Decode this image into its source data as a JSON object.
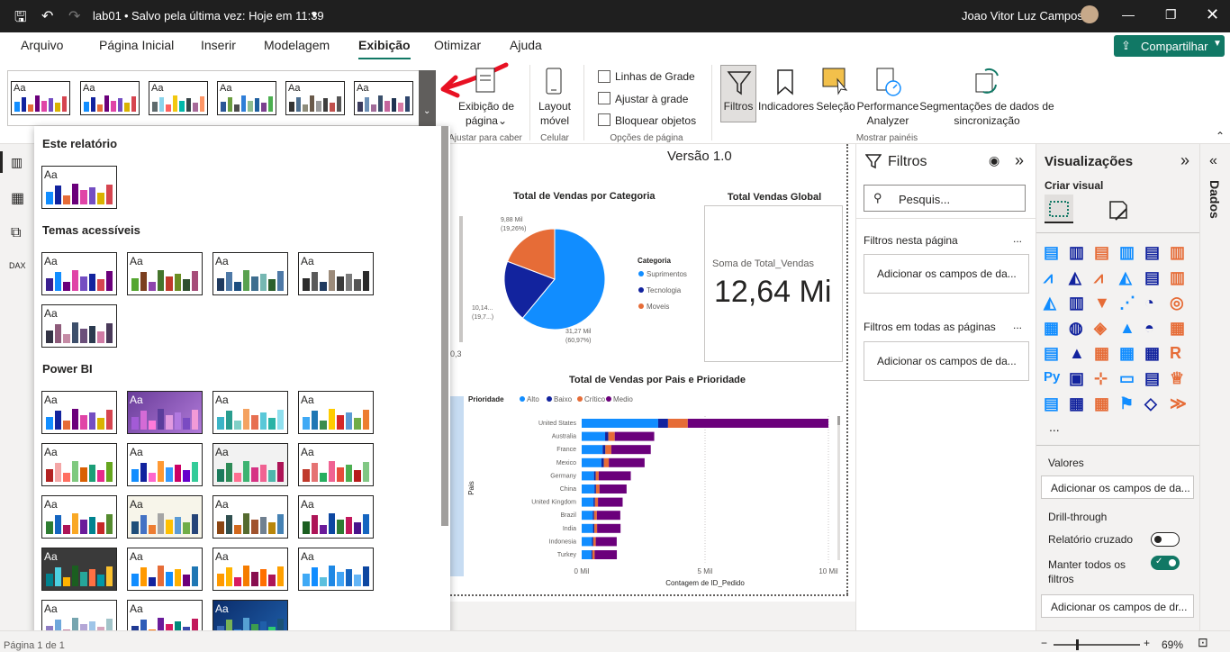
{
  "titlebar": {
    "file": "lab01",
    "save_status": "Salvo pela última vez: Hoje em 11:39",
    "user": "Joao Vitor Luz Campos"
  },
  "tabs": [
    "Arquivo",
    "Página Inicial",
    "Inserir",
    "Modelagem",
    "Exibição",
    "Otimizar",
    "Ajuda"
  ],
  "share_label": "Compartilhar",
  "ribbon": {
    "page_view": "Exibição de página",
    "page_view_chevron": "⌄",
    "fit_group": "Ajustar para caber",
    "mobile_layout": "Layout móvel",
    "mobile_group": "Celular",
    "checkbox_gridlines": "Linhas de Grade",
    "checkbox_snap": "Ajustar à grade",
    "checkbox_lock": "Bloquear objetos",
    "page_options_group": "Opções de página",
    "filters": "Filtros",
    "bookmarks": "Indicadores",
    "selection": "Seleção",
    "performance": "Performance Analyzer",
    "sync_slicers": "Segmentações de dados de sincronização",
    "show_panes_group": "Mostrar painéis"
  },
  "themes_panel": {
    "section_report": "Este relatório",
    "section_accessible": "Temas acessíveis",
    "section_powerbi": "Power BI",
    "aa": "Aa"
  },
  "canvas": {
    "version": "Versão 1.0",
    "pie_title": "Total de Vendas por Categoria",
    "pie_legend_title": "Categoria",
    "card_title": "Total Vendas Global",
    "card_label": "Soma de Total_Vendas",
    "card_value": "12,64 Mi",
    "bar_title": "Total de Vendas por Pais e Prioridade",
    "bar_legend_title": "Prioridade",
    "bar_ylabel": "Pais",
    "bar_xlabel": "Contagem de ID_Pedido",
    "left_partial_label": "0,3"
  },
  "chart_data": [
    {
      "type": "pie",
      "title": "Total de Vendas por Categoria",
      "legend_title": "Categoria",
      "categories": [
        "Suprimentos",
        "Tecnologia",
        "Moveis"
      ],
      "values": [
        31.27,
        10.14,
        9.88
      ],
      "labels": [
        "31,27 Mil (60,97%)",
        "10,14... (19,7...)",
        "9,88 Mil (19,26%)"
      ],
      "label_lines": [
        [
          "31,27 Mil",
          "(60,97%)"
        ],
        [
          "10,14...",
          "(19,7...)"
        ],
        [
          "9,88 Mil",
          "(19,26%)"
        ]
      ],
      "percent": [
        60.97,
        19.7,
        19.26
      ],
      "colors": [
        "#118dff",
        "#12239e",
        "#e66c37"
      ]
    },
    {
      "type": "bar",
      "title": "Total de Vendas por Pais e Prioridade",
      "xlabel": "Contagem de ID_Pedido",
      "ylabel": "Pais",
      "categories": [
        "United States",
        "Australia",
        "France",
        "Mexico",
        "Germany",
        "China",
        "United Kingdom",
        "Brazil",
        "India",
        "Indonesia",
        "Turkey"
      ],
      "series": [
        {
          "name": "Alto",
          "color": "#118dff",
          "values": [
            3100,
            950,
            850,
            800,
            500,
            520,
            480,
            450,
            460,
            420,
            390
          ]
        },
        {
          "name": "Baixo",
          "color": "#12239e",
          "values": [
            400,
            130,
            110,
            100,
            70,
            60,
            60,
            55,
            55,
            50,
            45
          ]
        },
        {
          "name": "Crítico",
          "color": "#e66c37",
          "values": [
            800,
            260,
            240,
            200,
            120,
            140,
            120,
            110,
            110,
            100,
            90
          ]
        },
        {
          "name": "Medio",
          "color": "#6b007b",
          "values": [
            5700,
            1600,
            1600,
            1450,
            1300,
            1100,
            1000,
            950,
            950,
            850,
            900
          ]
        }
      ],
      "xticks": [
        "0 Mil",
        "5 Mil",
        "10 Mil"
      ],
      "xlim": [
        0,
        10000
      ]
    }
  ],
  "filters": {
    "title": "Filtros",
    "search_placeholder": "Pesquis...",
    "page_filters": "Filtros nesta página",
    "all_pages_filters": "Filtros em todas as páginas",
    "add_fields": "Adicionar os campos de da...",
    "more": "..."
  },
  "visualizations": {
    "title": "Visualizações",
    "create_visual": "Criar visual",
    "more": "...",
    "values_label": "Valores",
    "add_fields": "Adicionar os campos de da...",
    "drillthrough": "Drill-through",
    "cross_report": "Relatório cruzado",
    "keep_filters": "Manter todos os filtros",
    "add_drill": "Adicionar os campos de dr...",
    "py_label": "Py",
    "r_label": "R"
  },
  "data_pane": {
    "title": "Dados"
  },
  "status": {
    "page": "Página 1 de 1",
    "zoom": "69%"
  },
  "colors": {
    "accent": "#117865",
    "titlebar": "#1f1f1f"
  }
}
